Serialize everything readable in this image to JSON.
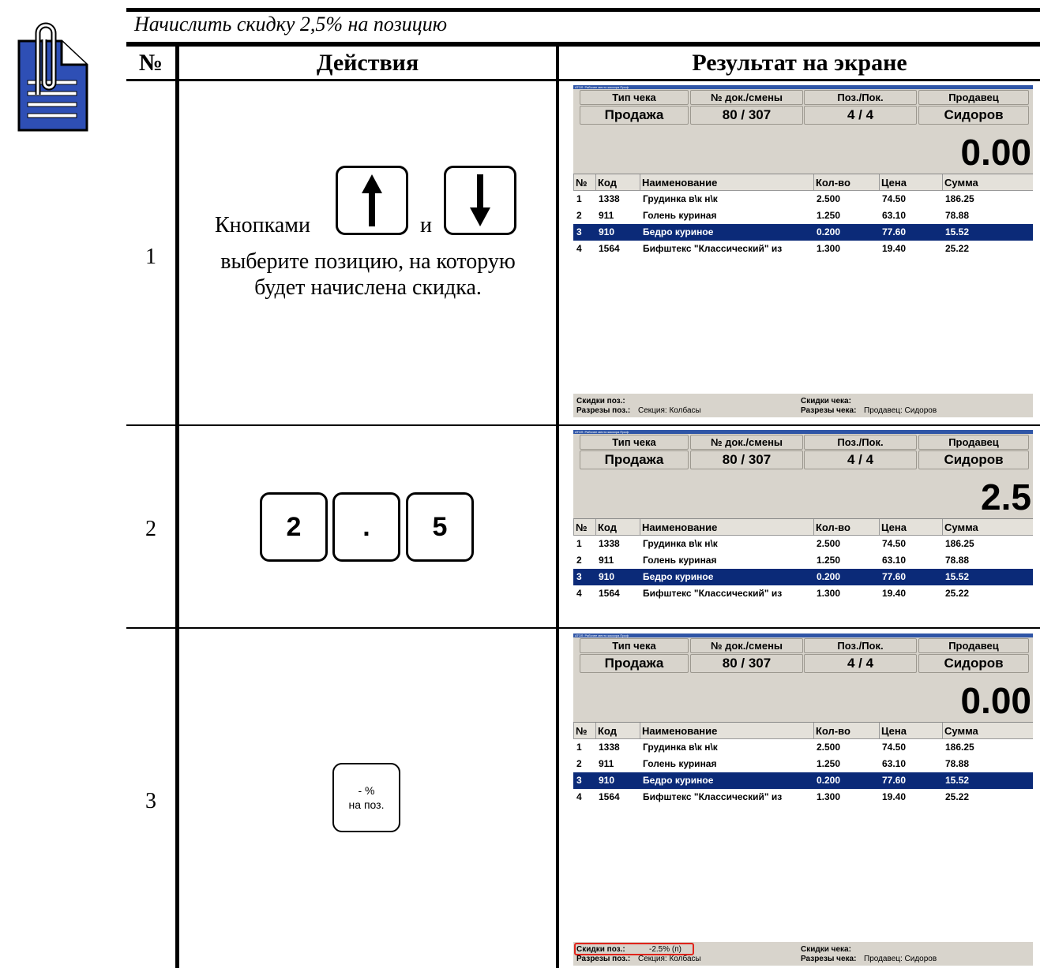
{
  "caption": "Начислить скидку 2,5% на позицию",
  "headers": {
    "num": "№",
    "actions": "Действия",
    "result": "Результат на экране"
  },
  "steps": [
    {
      "num": "1",
      "text_before": "Кнопками",
      "text_and": "и",
      "text_after": "выберите позицию, на которую будет начислена скидка."
    },
    {
      "num": "2",
      "keys": [
        "2",
        ".",
        "5"
      ]
    },
    {
      "num": "3",
      "key_line1": "- %",
      "key_line2": "на поз."
    }
  ],
  "pos": {
    "window_title": "АТОЛ: Рабочее место кассира Проф",
    "labels": {
      "type": "Тип чека",
      "doc": "№ док./смены",
      "pos": "Поз./Пок.",
      "seller": "Продавец"
    },
    "values": {
      "type": "Продажа",
      "doc": "80 / 307",
      "pos": "4 / 4",
      "seller": "Сидоров"
    },
    "columns": [
      "№",
      "Код",
      "Наименование",
      "Кол-во",
      "Цена",
      "Сумма"
    ],
    "rows": [
      [
        "1",
        "1338",
        "Грудинка в\\к н\\к",
        "2.500",
        "74.50",
        "186.25"
      ],
      [
        "2",
        "911",
        "Голень куриная",
        "1.250",
        "63.10",
        "78.88"
      ],
      [
        "3",
        "910",
        "Бедро куриное",
        "0.200",
        "77.60",
        "15.52"
      ],
      [
        "4",
        "1564",
        "Бифштекс \"Классический\" из",
        "1.300",
        "19.40",
        "25.22"
      ]
    ],
    "selected_row": 3,
    "footer": {
      "disc_pos_label": "Скидки поз.:",
      "cut_pos_label": "Разрезы поз.:",
      "cut_pos_value": "Секция: Колбасы",
      "disc_check_label": "Скидки чека:",
      "cut_check_label": "Разрезы чека:",
      "cut_check_value": "Продавец: Сидоров",
      "disc_pos_value_3": "-2.5% (п)"
    },
    "display": [
      "0.00",
      "2.5",
      "0.00"
    ],
    "highlight_color": "#0b2a78",
    "accent_red": "#e0241b"
  }
}
